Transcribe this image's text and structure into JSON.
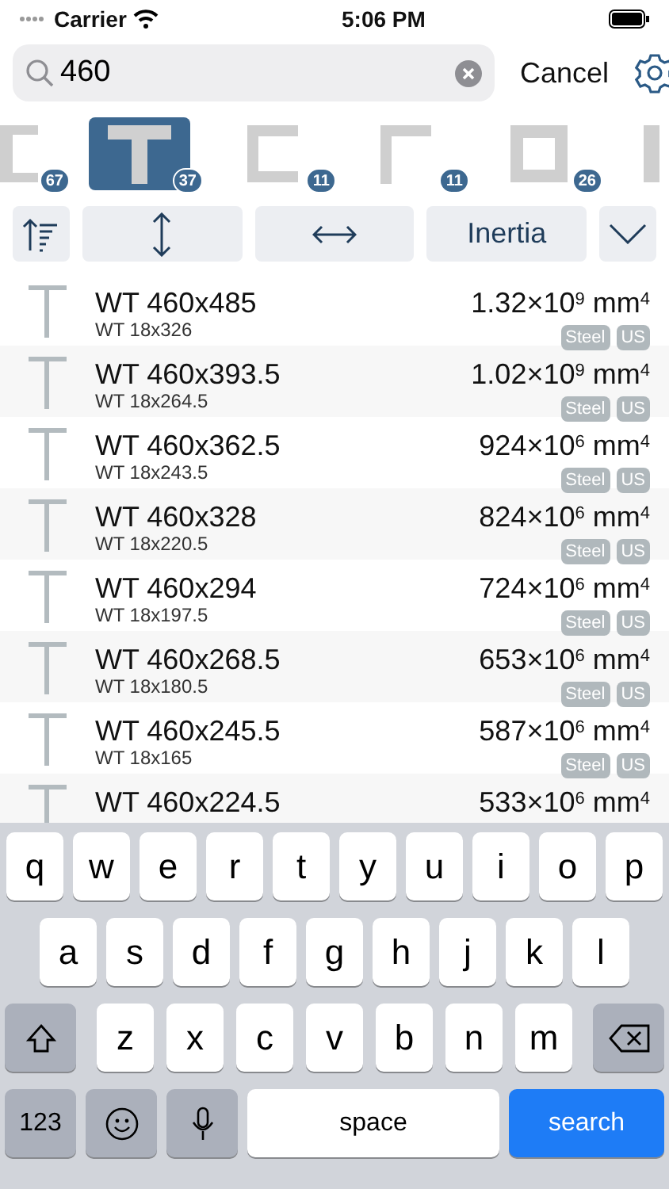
{
  "status_bar": {
    "carrier": "Carrier",
    "time": "5:06 PM"
  },
  "search": {
    "value": "460",
    "cancel": "Cancel"
  },
  "shapes": [
    {
      "kind": "i-beam",
      "count": "67",
      "selected": false
    },
    {
      "kind": "tee",
      "count": "37",
      "selected": true
    },
    {
      "kind": "channel",
      "count": "11",
      "selected": false
    },
    {
      "kind": "angle",
      "count": "11",
      "selected": false
    },
    {
      "kind": "tube",
      "count": "26",
      "selected": false
    },
    {
      "kind": "pipe",
      "selected": false
    }
  ],
  "toolbar": [
    {
      "kind": "sort"
    },
    {
      "kind": "depth"
    },
    {
      "kind": "width"
    },
    {
      "kind": "text",
      "label": "Inertia"
    },
    {
      "kind": "more"
    }
  ],
  "rows": [
    {
      "name": "WT 460x485",
      "alias": "WT 18x326",
      "value": "1.32×10$^{9}$ mm$^{4}$",
      "tags": [
        "Steel",
        "US"
      ]
    },
    {
      "name": "WT 460x393.5",
      "alias": "WT 18x264.5",
      "value": "1.02×10$^{9}$ mm$^{4}$",
      "tags": [
        "Steel",
        "US"
      ]
    },
    {
      "name": "WT 460x362.5",
      "alias": "WT 18x243.5",
      "value": "924×10$^{6}$ mm$^{4}$",
      "tags": [
        "Steel",
        "US"
      ]
    },
    {
      "name": "WT 460x328",
      "alias": "WT 18x220.5",
      "value": "824×10$^{6}$ mm$^{4}$",
      "tags": [
        "Steel",
        "US"
      ]
    },
    {
      "name": "WT 460x294",
      "alias": "WT 18x197.5",
      "value": "724×10$^{6}$ mm$^{4}$",
      "tags": [
        "Steel",
        "US"
      ]
    },
    {
      "name": "WT 460x268.5",
      "alias": "WT 18x180.5",
      "value": "653×10$^{6}$ mm$^{4}$",
      "tags": [
        "Steel",
        "US"
      ]
    },
    {
      "name": "WT 460x245.5",
      "alias": "WT 18x165",
      "value": "587×10$^{6}$ mm$^{4}$",
      "tags": [
        "Steel",
        "US"
      ]
    },
    {
      "name": "WT 460x224.5",
      "value": "533×10$^{6}$ mm$^{4}$"
    }
  ],
  "keyboard": {
    "rows": [
      {
        "keys": [
          {
            "kind": "key",
            "label": "q"
          },
          {
            "kind": "key",
            "label": "w"
          },
          {
            "kind": "key",
            "label": "e"
          },
          {
            "kind": "key",
            "label": "r"
          },
          {
            "kind": "key",
            "label": "t"
          },
          {
            "kind": "key",
            "label": "y"
          },
          {
            "kind": "key",
            "label": "u"
          },
          {
            "kind": "key",
            "label": "i"
          },
          {
            "kind": "key",
            "label": "o"
          },
          {
            "kind": "key",
            "label": "p"
          }
        ]
      },
      {
        "keys": [
          {
            "kind": "key",
            "label": "a"
          },
          {
            "kind": "key",
            "label": "s"
          },
          {
            "kind": "key",
            "label": "d"
          },
          {
            "kind": "key",
            "label": "f"
          },
          {
            "kind": "key",
            "label": "g"
          },
          {
            "kind": "key",
            "label": "h"
          },
          {
            "kind": "key",
            "label": "j"
          },
          {
            "kind": "key",
            "label": "k"
          },
          {
            "kind": "key",
            "label": "l"
          }
        ]
      },
      {
        "keys": [
          {
            "kind": "shift"
          },
          {
            "kind": "key",
            "label": "z"
          },
          {
            "kind": "key",
            "label": "x"
          },
          {
            "kind": "key",
            "label": "c"
          },
          {
            "kind": "key",
            "label": "v"
          },
          {
            "kind": "key",
            "label": "b"
          },
          {
            "kind": "key",
            "label": "n"
          },
          {
            "kind": "key",
            "label": "m"
          },
          {
            "kind": "delete"
          }
        ]
      },
      {
        "keys": [
          {
            "kind": "mode",
            "label": "123"
          },
          {
            "kind": "emoji"
          },
          {
            "kind": "mic"
          },
          {
            "kind": "space",
            "label": "space"
          },
          {
            "kind": "action",
            "label": "search"
          }
        ]
      }
    ]
  }
}
